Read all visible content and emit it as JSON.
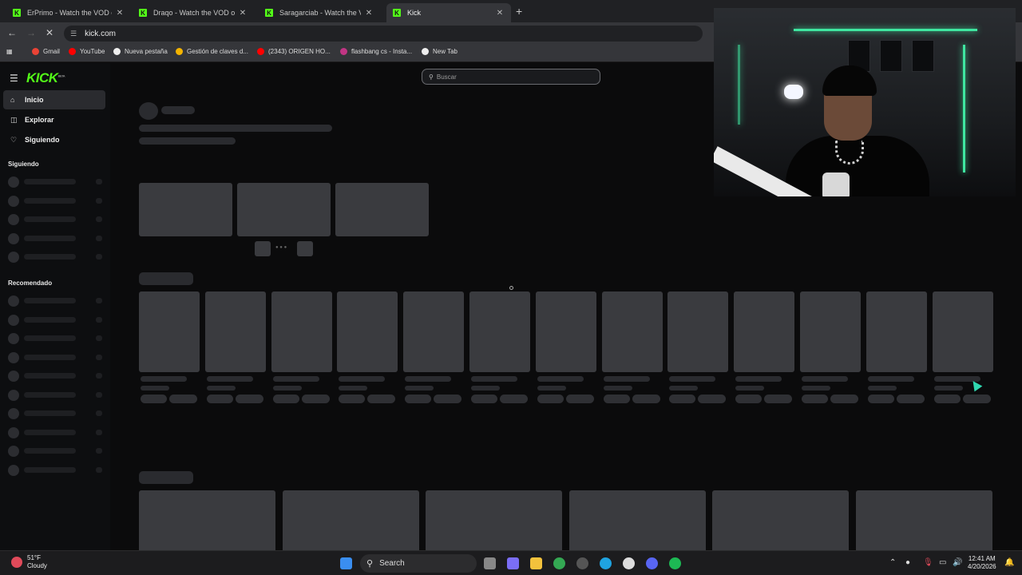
{
  "browser": {
    "tabs": [
      {
        "label": "ErPrimo - Watch the VOD on Kick",
        "active": false
      },
      {
        "label": "Draqo - Watch the VOD on Kick",
        "active": false
      },
      {
        "label": "Saragarciab - Watch the VOD on Kick",
        "active": false
      },
      {
        "label": "Kick",
        "active": true
      }
    ],
    "new_tab_symbol": "+",
    "close_symbol": "✕",
    "url": "kick.com",
    "bookmarks": [
      {
        "label": "Gmail",
        "color": "#ea4335"
      },
      {
        "label": "YouTube",
        "color": "#ff0000"
      },
      {
        "label": "Nueva pestaña",
        "color": "#ffffff"
      },
      {
        "label": "Gestión de claves d...",
        "color": "#f4b400"
      },
      {
        "label": "(2343) ORIGEN HO...",
        "color": "#ff0000"
      },
      {
        "label": "flashbang cs - Insta...",
        "color": "#c13584"
      },
      {
        "label": "New Tab",
        "color": "#ffffff"
      }
    ]
  },
  "kick": {
    "logo": "KICK",
    "logo_tag": "BETA",
    "nav": [
      {
        "label": "Inicio",
        "icon": "home-icon",
        "active": true
      },
      {
        "label": "Explorar",
        "icon": "compass-icon",
        "active": false
      },
      {
        "label": "Siguiendo",
        "icon": "heart-icon",
        "active": false
      }
    ],
    "following_title": "Siguiendo",
    "recommended_title": "Recomendado",
    "search_placeholder": "Buscar",
    "accent": "#53fc18"
  },
  "taskbar": {
    "weather_temp": "51°F",
    "weather_desc": "Cloudy",
    "search_label": "Search",
    "time": "12:41 AM",
    "date": "4/20/2026"
  }
}
